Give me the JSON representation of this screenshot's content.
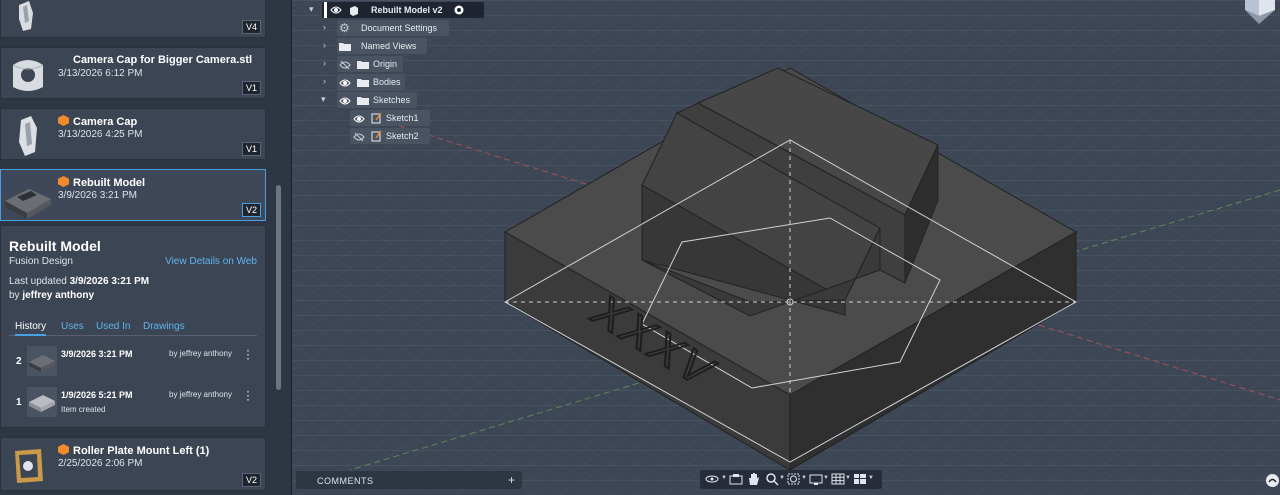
{
  "left_panel": {
    "cards": [
      {
        "title": "",
        "date": "",
        "version": "V4"
      },
      {
        "title": "Camera Cap for Bigger Camera.stl",
        "date": "3/13/2026 6:12 PM",
        "version": "V1"
      },
      {
        "title": "Camera Cap",
        "date": "3/13/2026 4:25 PM",
        "version": "V1"
      },
      {
        "title": "Rebuilt Model",
        "date": "3/9/2026 3:21 PM",
        "version": "V2"
      },
      {
        "title": "Roller Plate Mount Left (1)",
        "date": "2/25/2026 2:06 PM",
        "version": "V2"
      }
    ],
    "details": {
      "title": "Rebuilt Model",
      "subtitle": "Fusion Design",
      "link": "View Details on Web",
      "updated_label": "Last updated",
      "updated_value": "3/9/2026 3:21 PM",
      "by_label": "by",
      "by_value": "jeffrey anthony",
      "tabs": [
        "History",
        "Uses",
        "Used In",
        "Drawings"
      ],
      "active_tab": "History",
      "history": [
        {
          "num": "2",
          "date": "3/9/2026 3:21 PM",
          "by": "by jeffrey anthony",
          "note": ""
        },
        {
          "num": "1",
          "date": "1/9/2026 5:21 PM",
          "by": "by jeffrey anthony",
          "note": "Item created"
        }
      ]
    }
  },
  "browser": {
    "root": "Rebuilt Model v2",
    "items": [
      {
        "label": "Document Settings",
        "icon": "gear-icon"
      },
      {
        "label": "Named Views",
        "icon": "folder-icon"
      },
      {
        "label": "Origin",
        "icon": "folder-icon",
        "visibility": "hidden"
      },
      {
        "label": "Bodies",
        "icon": "folder-icon",
        "visibility": "visible"
      },
      {
        "label": "Sketches",
        "icon": "folder-icon",
        "visibility": "visible"
      },
      {
        "label": "Sketch1",
        "icon": "sketch-icon",
        "visibility": "visible"
      },
      {
        "label": "Sketch2",
        "icon": "sketch-icon",
        "visibility": "hidden"
      }
    ]
  },
  "model_engraving": "XXXV",
  "comments": {
    "label": "COMMENTS",
    "add": "+"
  },
  "colors": {
    "accent": "#4aa0e0",
    "link": "#5fb4f0",
    "panel": "#2e3643",
    "card": "#3c4553",
    "viewport": "#3d4654",
    "model": "#414141",
    "cube_icon": "#f08a2a"
  }
}
